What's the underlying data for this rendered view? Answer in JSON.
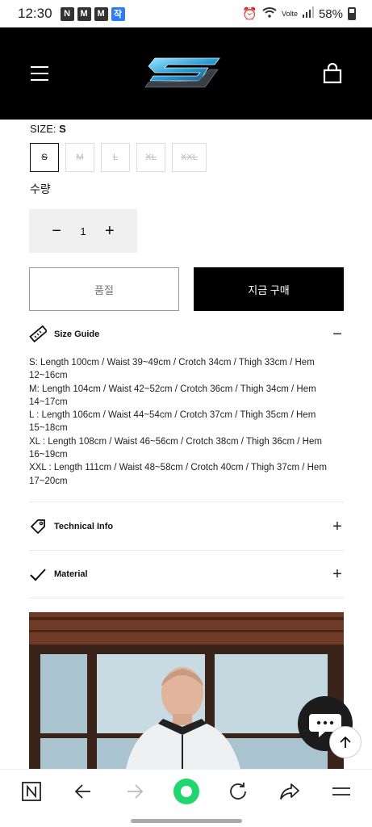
{
  "status_bar": {
    "time": "12:30",
    "apps": [
      "N",
      "M",
      "M",
      "작"
    ],
    "network": "Volte",
    "battery": "58%"
  },
  "header": {
    "menu_icon": "hamburger-icon",
    "logo_icon": "brand-logo",
    "bag_icon": "shopping-bag-icon"
  },
  "product": {
    "size_label": "SIZE:",
    "size_selected": "S",
    "sizes": [
      "S",
      "M",
      "L",
      "XL",
      "XXL"
    ],
    "quantity_label": "수량",
    "quantity_value": "1",
    "sold_out_label": "품절",
    "buy_now_label": "지금 구매"
  },
  "size_guide": {
    "title": "Size Guide",
    "toggle": "−",
    "lines": [
      "S: Length 100cm / Waist 39~49cm / Crotch 34cm / Thigh 33cm / Hem 12~16cm",
      "M: Length 104cm / Waist 42~52cm / Crotch 36cm / Thigh 34cm / Hem 14~17cm",
      "L : Length 106cm / Waist 44~54cm / Crotch 37cm / Thigh 35cm / Hem 15~18cm",
      "XL : Length 108cm / Waist 46~56cm / Crotch 38cm / Thigh 36cm / Hem 16~19cm",
      "XXL : Length 111cm / Waist 48~58cm / Crotch 40cm / Thigh 37cm / Hem 17~20cm"
    ]
  },
  "technical_info": {
    "title": "Technical Info",
    "toggle": "+"
  },
  "material": {
    "title": "Material",
    "toggle": "+"
  },
  "colors": {
    "header_bg": "#000000",
    "accent": "#1fd66f"
  }
}
